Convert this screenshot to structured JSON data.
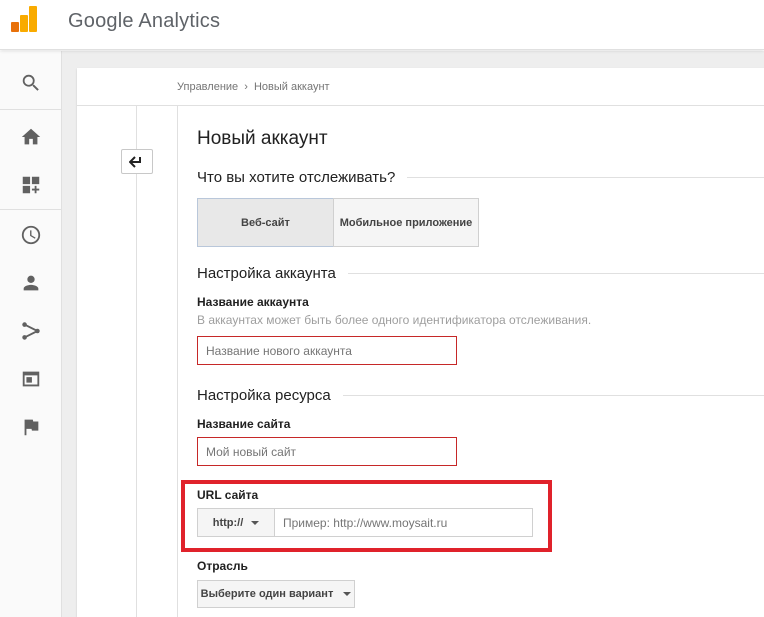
{
  "app": {
    "title": "Google Analytics"
  },
  "breadcrumb": {
    "parent": "Управление",
    "separator": "›",
    "current": "Новый аккаунт"
  },
  "page": {
    "title": "Новый аккаунт"
  },
  "tracking": {
    "question": "Что вы хотите отслеживать?",
    "tabs": [
      {
        "label": "Веб-сайт",
        "selected": true
      },
      {
        "label": "Мобильное приложение",
        "selected": false
      }
    ]
  },
  "account_settings": {
    "heading": "Настройка аккаунта",
    "name_label": "Название аккаунта",
    "name_hint": "В аккаунтах может быть более одного идентификатора отслеживания.",
    "name_placeholder": "Название нового аккаунта",
    "name_value": ""
  },
  "property_settings": {
    "heading": "Настройка ресурса",
    "site_name_label": "Название сайта",
    "site_name_placeholder": "Мой новый сайт",
    "site_name_value": "",
    "url_label": "URL сайта",
    "protocol_selected": "http://",
    "url_placeholder": "Пример: http://www.moysait.ru",
    "url_value": "",
    "industry_label": "Отрасль",
    "industry_selected": "Выберите один вариант"
  },
  "nav_icons": [
    "search-icon",
    "home-icon",
    "customization-icon",
    "realtime-clock-icon",
    "audience-person-icon",
    "acquisition-icon",
    "behavior-icon",
    "conversions-flag-icon"
  ],
  "colors": {
    "error_border": "#c62828",
    "highlight_box": "#e0222b",
    "logo_dark": "#e8710a",
    "logo_light": "#f9ab00"
  }
}
